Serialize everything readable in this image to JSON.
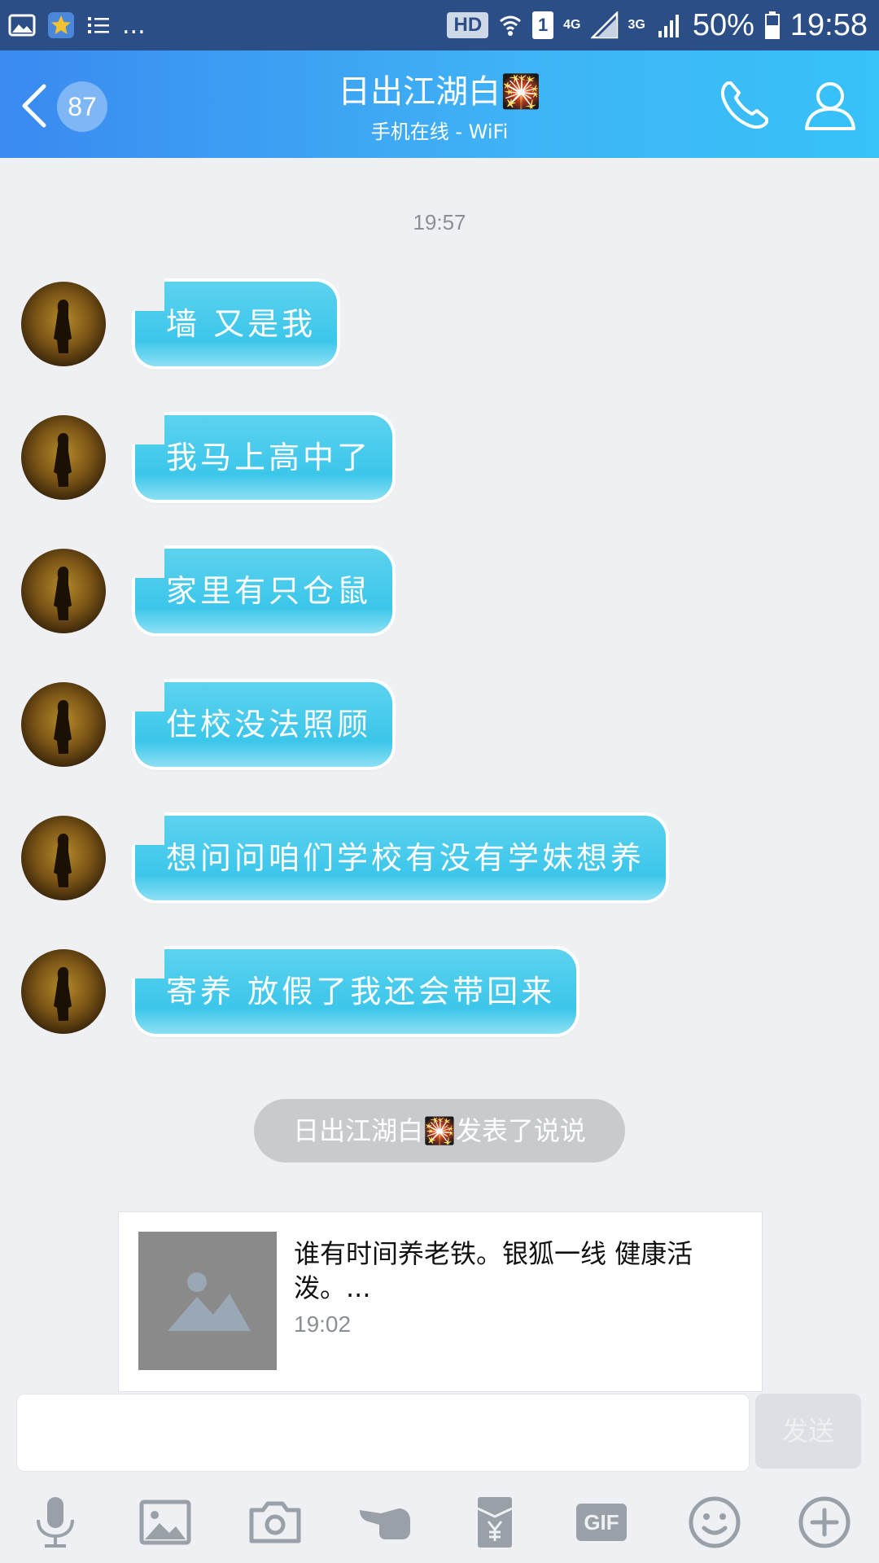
{
  "status_bar": {
    "network_hd": "HD",
    "sim_slot": "1",
    "net_4g": "4G",
    "net_3g": "3G",
    "battery": "50%",
    "time": "19:58",
    "more": "..."
  },
  "header": {
    "unread_count": "87",
    "contact_name": "日出江湖白🎇",
    "status": "手机在线 - WiFi"
  },
  "chat": {
    "timestamp": "19:57",
    "messages": [
      {
        "text": "墙 又是我"
      },
      {
        "text": "我马上高中了"
      },
      {
        "text": "家里有只仓鼠"
      },
      {
        "text": "住校没法照顾"
      },
      {
        "text": "想问问咱们学校有没有学妹想养"
      },
      {
        "text": "寄养 放假了我还会带回来"
      }
    ],
    "system_notice": "日出江湖白🎇发表了说说",
    "post_card": {
      "text": "谁有时间养老铁。银狐一线 健康活泼。...",
      "time": "19:02"
    }
  },
  "composer": {
    "send_label": "发送",
    "input_value": ""
  },
  "toolbar": {
    "gif_label": "GIF",
    "icons": [
      "microphone-icon",
      "image-icon",
      "camera-icon",
      "poke-icon",
      "red-packet-icon",
      "gif-icon",
      "emoji-icon",
      "plus-icon"
    ]
  },
  "colors": {
    "status_bar": "#2c4e87",
    "header_start": "#3a8af0",
    "header_end": "#37c2f8",
    "bubble": "#45c9ec",
    "background": "#eef0f4"
  }
}
